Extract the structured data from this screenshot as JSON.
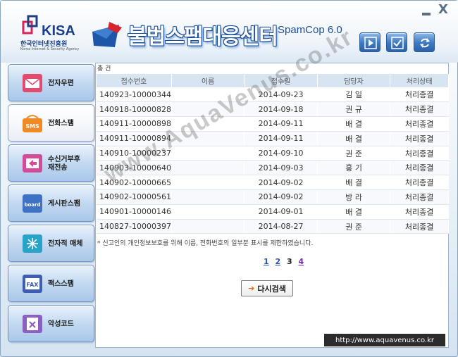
{
  "header": {
    "org_name": "KISA",
    "org_name_kor": "한국인터넷진흥원",
    "org_name_eng": "Korea Internet & Security Agency",
    "app_title": "불법스팸대응센터",
    "app_version": "SpamCop 6.0",
    "window_minimize": "_",
    "window_close": "X",
    "toolbar_icons": [
      "arrow-right-icon",
      "check-icon",
      "refresh-icon"
    ]
  },
  "sidebar": {
    "items": [
      {
        "label": "전자우편",
        "icon": "email-icon",
        "icon_color": "#e24a6f"
      },
      {
        "label": "전화스팸",
        "icon": "sms-icon",
        "icon_text": "SMS",
        "icon_color": "#f08a24"
      },
      {
        "label": "수신거부후\n재전송",
        "icon": "resend-icon",
        "icon_color": "#d44b9a"
      },
      {
        "label": "게시판스팸",
        "icon": "board-icon",
        "icon_text": "board",
        "icon_color": "#3d72c4"
      },
      {
        "label": "전자적 매체",
        "icon": "media-icon",
        "icon_color": "#2aa3c9"
      },
      {
        "label": "팩스스팸",
        "icon": "fax-icon",
        "icon_text": "FAX",
        "icon_color": "#3e5fb1"
      },
      {
        "label": "악성코드",
        "icon": "malware-icon",
        "icon_color": "#8c5fc0"
      }
    ],
    "active_index": 1
  },
  "content": {
    "total_line": "총 건",
    "columns": [
      "접수번호",
      "이름",
      "접수일",
      "담당자",
      "처리상태"
    ],
    "rows": [
      [
        "140923-10000344",
        "",
        "2014-09-23",
        "김 일",
        "처리종결"
      ],
      [
        "140918-10000828",
        "",
        "2014-09-18",
        "권 규",
        "처리종결"
      ],
      [
        "140911-10000898",
        "",
        "2014-09-11",
        "배 결",
        "처리종결"
      ],
      [
        "140911-10000894",
        "",
        "2014-09-11",
        "배 결",
        "처리종결"
      ],
      [
        "140910-10000237",
        "",
        "2014-09-10",
        "권 준",
        "처리종결"
      ],
      [
        "140903-10000640",
        "",
        "2014-09-03",
        "홍 기",
        "처리종결"
      ],
      [
        "140902-10000665",
        "",
        "2014-09-02",
        "배 결",
        "처리종결"
      ],
      [
        "140902-10000561",
        "",
        "2014-09-02",
        "방 라",
        "처리종결"
      ],
      [
        "140901-10000146",
        "",
        "2014-09-01",
        "배 결",
        "처리종결"
      ],
      [
        "140827-10000397",
        "",
        "2014-08-27",
        "권 준",
        "처리종결"
      ]
    ],
    "notice": "* 신고인의 개인정보보호를 위해 이름, 전화번호의 일부분 표시를 제한하였습니다.",
    "pages": [
      "1",
      "2",
      "3",
      "4"
    ],
    "current_page": "3",
    "research_button": "다시검색"
  },
  "watermark": "www.AquaVenus.co.kr",
  "url_label": "http://www.aquavenus.co.kr",
  "colors": {
    "accent": "#2c62a8",
    "header_text": "#1d3f8a",
    "grid_header": "#d7e4f2",
    "link": "#2a55b4"
  }
}
